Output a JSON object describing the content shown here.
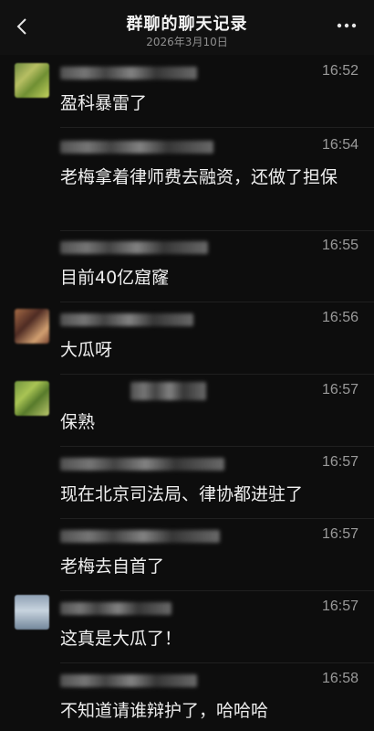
{
  "header": {
    "title": "群聊的聊天记录",
    "date": "2026年3月10日"
  },
  "messages": [
    {
      "time": "16:52",
      "text": "盈科暴雷了"
    },
    {
      "time": "16:54",
      "text": "老梅拿着律师费去融资，还做了担保"
    },
    {
      "time": "16:55",
      "text": "目前40亿窟窿"
    },
    {
      "time": "16:56",
      "text": "大瓜呀"
    },
    {
      "time": "16:57",
      "text": "保熟"
    },
    {
      "time": "16:57",
      "text": "现在北京司法局、律协都进驻了"
    },
    {
      "time": "16:57",
      "text": "老梅去自首了"
    },
    {
      "time": "16:57",
      "text": "这真是大瓜了！"
    },
    {
      "time": "16:58",
      "text": "不知道请谁辩护了，哈哈哈"
    }
  ]
}
